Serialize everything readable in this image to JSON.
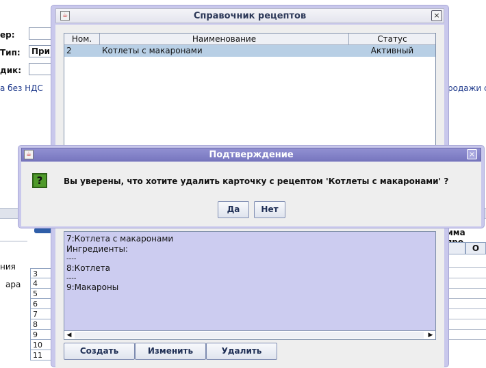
{
  "background": {
    "labels": [
      "ер:",
      "Тип:",
      "дик:"
    ],
    "type_value": "При",
    "no_vat_text": "а без НДС",
    "sales_text": "родажи с",
    "left_list": [
      "ния",
      "ара"
    ],
    "row_numbers": [
      "3",
      "4",
      "5",
      "6",
      "7",
      "8",
      "9",
      "10",
      "11"
    ],
    "right_header": "мма про,",
    "right_col": "О"
  },
  "main_window": {
    "title": "Справочник рецептов",
    "close_glyph": "×",
    "columns": [
      "Ном.",
      "Наименование",
      "Статус"
    ],
    "rows": [
      {
        "num": "2",
        "name": "Котлеты с макаронами",
        "status": "Активный"
      }
    ],
    "details": [
      "7:Котлета с макаронами",
      "Ингредиенты:",
      "----",
      "8:Котлета",
      "----",
      "9:Макароны"
    ],
    "scroll_left_glyph": "◀",
    "scroll_right_glyph": "▶",
    "buttons": {
      "create": "Создать",
      "edit": "Изменить",
      "delete": "Удалить"
    }
  },
  "dialog": {
    "title": "Подтверждение",
    "close_glyph": "×",
    "icon_glyph": "?",
    "message": "Вы уверены, что хотите удалить карточку с рецептом 'Котлеты с макаронами' ?",
    "yes": "Да",
    "no": "Нет"
  },
  "colors": {
    "window_frame": "#c9c8ec",
    "dialog_title": "#7877bf",
    "selected_row": "#b8cfe5",
    "detail_bg": "#ccccf0"
  }
}
